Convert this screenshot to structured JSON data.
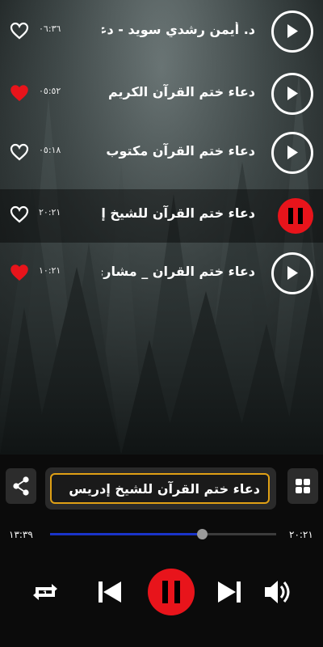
{
  "tracks": [
    {
      "title": "د. أيمن رشدي سويد - دعاء ختم القرآن",
      "duration": "٠٦:٣٦",
      "favorite": false,
      "playing": false
    },
    {
      "title": "دعاء ختم القرآن الكريم",
      "duration": "٠٥:٥٢",
      "favorite": true,
      "playing": false
    },
    {
      "title": "دعاء ختم القرآن مكتوب",
      "duration": "٠٥:١٨",
      "favorite": false,
      "playing": false
    },
    {
      "title": "دعاء ختم القرآن للشيخ إدريس",
      "duration": "٢٠:٢١",
      "favorite": false,
      "playing": true
    },
    {
      "title": "دعاء ختم القران _ مشاري",
      "duration": "١٠:٢١",
      "favorite": true,
      "playing": false
    }
  ],
  "player": {
    "now_playing": "دعاء ختم القرآن للشيخ إدريس",
    "elapsed": "١٣:٣٩",
    "total": "٢٠:٢١",
    "progress": 0.67
  },
  "colors": {
    "accent_red": "#e8141b",
    "progress_blue": "#1a34c9",
    "title_border": "#e0a015"
  },
  "icons": {
    "share": "share-icon",
    "grid": "grid-icon",
    "repeat": "repeat-one-icon",
    "previous": "skip-previous-icon",
    "pause": "pause-icon",
    "next": "skip-next-icon",
    "volume": "volume-icon",
    "heart": "heart-icon",
    "play": "play-icon"
  }
}
